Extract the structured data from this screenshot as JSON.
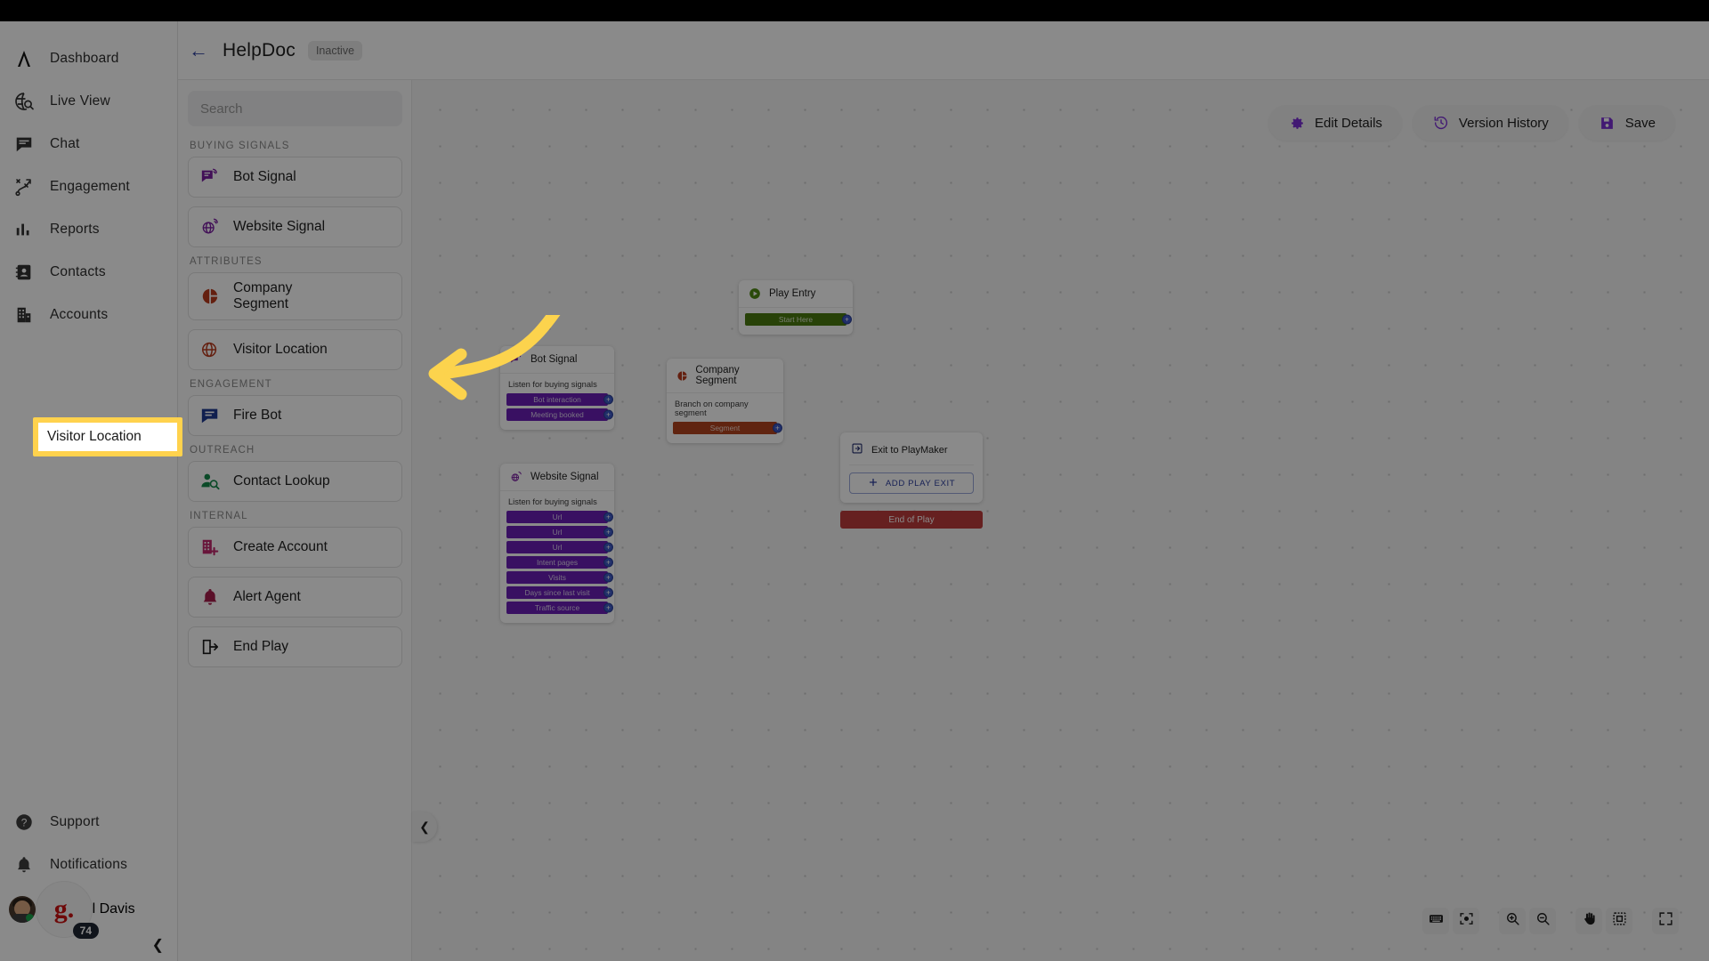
{
  "app": {
    "product_nav": [
      {
        "label": "Dashboard",
        "icon": "logo-lambda-icon"
      },
      {
        "label": "Live View",
        "icon": "live-view-icon"
      },
      {
        "label": "Chat",
        "icon": "chat-icon"
      },
      {
        "label": "Engagement",
        "icon": "engagement-icon"
      },
      {
        "label": "Reports",
        "icon": "reports-icon"
      },
      {
        "label": "Contacts",
        "icon": "contacts-icon"
      },
      {
        "label": "Accounts",
        "icon": "accounts-icon"
      }
    ],
    "nav_footer": [
      {
        "label": "Support",
        "icon": "help-circle-icon"
      },
      {
        "label": "Notifications",
        "icon": "bell-icon"
      }
    ],
    "user": {
      "name": "Michael Davis",
      "badge_letter": "g.",
      "notification_count": "74"
    },
    "collapse_icon": "chevron-left-icon"
  },
  "topbar": {
    "back_icon": "arrow-left-icon",
    "title": "HelpDoc",
    "status": "Inactive"
  },
  "toolbar_right": [
    {
      "label": "Edit Details",
      "icon": "gear-icon"
    },
    {
      "label": "Version History",
      "icon": "history-icon"
    },
    {
      "label": "Save",
      "icon": "save-icon"
    }
  ],
  "panel": {
    "search_placeholder": "Search",
    "groups": [
      {
        "label": "BUYING SIGNALS",
        "items": [
          {
            "label": "Bot Signal",
            "icon": "bot-signal-icon",
            "color": "#7b1fa2"
          },
          {
            "label": "Website Signal",
            "icon": "website-signal-icon",
            "color": "#7b1fa2"
          }
        ]
      },
      {
        "label": "ATTRIBUTES",
        "items": [
          {
            "label": "Company Segment",
            "icon": "pie-chart-icon",
            "color": "#b93a1c"
          },
          {
            "label": "Visitor Location",
            "icon": "globe-location-icon",
            "color": "#b93a1c"
          }
        ]
      },
      {
        "label": "ENGAGEMENT",
        "items": [
          {
            "label": "Fire Bot",
            "icon": "chat-bubble-icon",
            "color": "#1f3a93"
          }
        ]
      },
      {
        "label": "OUTREACH",
        "items": [
          {
            "label": "Contact Lookup",
            "icon": "person-search-icon",
            "color": "#168a4a"
          }
        ]
      },
      {
        "label": "INTERNAL",
        "items": [
          {
            "label": "Create Account",
            "icon": "building-plus-icon",
            "color": "#c0276b"
          },
          {
            "label": "Alert Agent",
            "icon": "bell-icon",
            "color": "#a61e4d"
          },
          {
            "label": "End Play",
            "icon": "exit-icon",
            "color": "#1a1a1a"
          }
        ]
      }
    ],
    "collapse_icon": "chevron-left-icon"
  },
  "highlight": {
    "label": "Visitor Location",
    "border_color": "#ffd24d",
    "annotation_arrow_color": "#fcd34d"
  },
  "canvas": {
    "nodes": [
      {
        "id": "play-entry",
        "title": "Play Entry",
        "icon": "play-circle-icon",
        "subtitle": "",
        "rows": [
          {
            "label": "Start Here",
            "style": "green",
            "handle": "plus-handle"
          }
        ]
      },
      {
        "id": "bot-signal",
        "title": "Bot Signal",
        "icon": "bot-signal-icon",
        "subtitle": "Listen for buying signals",
        "rows": [
          {
            "label": "Bot interaction",
            "style": "purple",
            "handle": "plus-handle"
          },
          {
            "label": "Meeting booked",
            "style": "purple",
            "handle": "plus-handle"
          }
        ]
      },
      {
        "id": "company-segment",
        "title": "Company Segment",
        "icon": "pie-chart-icon",
        "subtitle": "Branch on company segment",
        "rows": [
          {
            "label": "Segment",
            "style": "rust",
            "handle": "plus-handle"
          }
        ]
      },
      {
        "id": "website-signal",
        "title": "Website Signal",
        "icon": "website-signal-icon",
        "subtitle": "Listen for buying signals",
        "rows": [
          {
            "label": "Url",
            "style": "purple",
            "handle": "plus-handle"
          },
          {
            "label": "Url",
            "style": "purple",
            "handle": "plus-handle"
          },
          {
            "label": "Url",
            "style": "purple",
            "handle": "plus-handle"
          },
          {
            "label": "Intent pages",
            "style": "purple",
            "handle": "plus-handle"
          },
          {
            "label": "Visits",
            "style": "purple",
            "handle": "plus-handle"
          },
          {
            "label": "Days since last visit",
            "style": "purple",
            "handle": "plus-handle"
          },
          {
            "label": "Traffic source",
            "style": "purple",
            "handle": "plus-handle"
          }
        ]
      }
    ],
    "exit_node": {
      "title": "Exit to PlayMaker",
      "icon": "exit-icon",
      "add_label": "ADD PLAY EXIT",
      "add_icon": "plus-icon",
      "end_label": "End of Play"
    },
    "tools": [
      {
        "icon": "keyboard-icon",
        "name": "keyboard-shortcuts"
      },
      {
        "icon": "focus-icon",
        "name": "center-view"
      },
      {
        "icon": "zoom-in-icon",
        "name": "zoom-in"
      },
      {
        "icon": "zoom-out-icon",
        "name": "zoom-out"
      },
      {
        "icon": "hand-icon",
        "name": "pan-tool"
      },
      {
        "icon": "select-box-icon",
        "name": "select-tool"
      },
      {
        "icon": "fullscreen-icon",
        "name": "fullscreen"
      }
    ]
  }
}
